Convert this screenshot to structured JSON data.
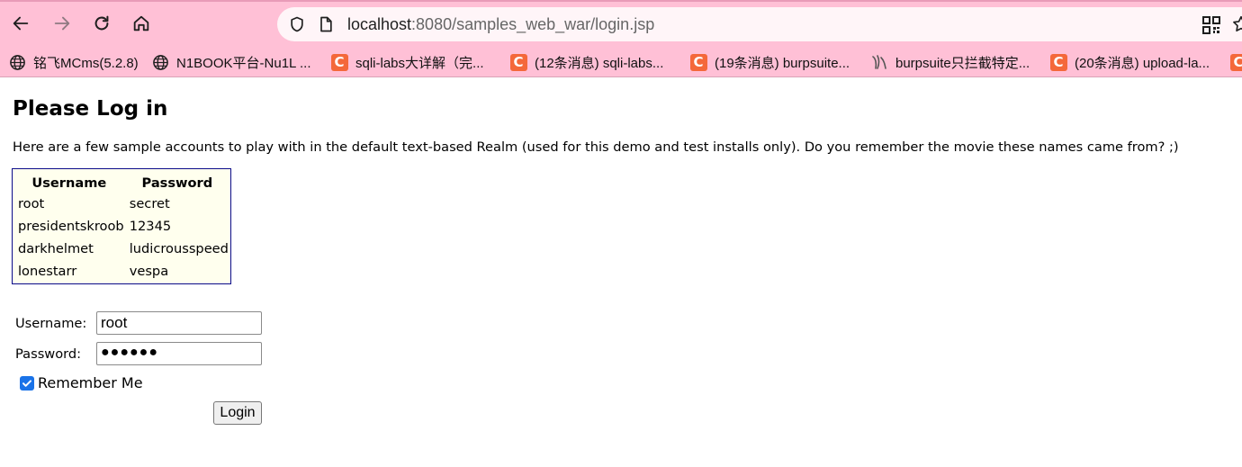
{
  "browser": {
    "url_host": "localhost",
    "url_rest": ":8080/samples_web_war/login.jsp",
    "bookmarks": [
      {
        "label": "铭飞MCms(5.2.8)",
        "icon": "globe-icon"
      },
      {
        "label": "N1BOOK平台-Nu1L ...",
        "icon": "globe-icon"
      },
      {
        "label": "sqli-labs大详解（完...",
        "icon": "csdn-icon"
      },
      {
        "label": "(12条消息) sqli-labs...",
        "icon": "csdn-icon"
      },
      {
        "label": "(19条消息) burpsuite...",
        "icon": "csdn-icon"
      },
      {
        "label": "burpsuite只拦截特定...",
        "icon": "site-icon"
      },
      {
        "label": "(20条消息) upload-la...",
        "icon": "csdn-icon"
      }
    ],
    "colors": {
      "toolbar_bg": "#ffc0d6",
      "csdn_orange": "#f4683a"
    }
  },
  "page": {
    "title": "Please Log in",
    "intro": "Here are a few sample accounts to play with in the default text-based Realm (used for this demo and test installs only). Do you remember the movie these names came from? ;)",
    "table": {
      "headers": [
        "Username",
        "Password"
      ],
      "rows": [
        [
          "root",
          "secret"
        ],
        [
          "presidentskroob",
          "12345"
        ],
        [
          "darkhelmet",
          "ludicrousspeed"
        ],
        [
          "lonestarr",
          "vespa"
        ]
      ]
    },
    "form": {
      "username_label": "Username:",
      "username_value": "root",
      "password_label": "Password:",
      "password_value": "●●●●●●",
      "remember_label": "Remember Me",
      "remember_checked": true,
      "login_label": "Login"
    }
  }
}
